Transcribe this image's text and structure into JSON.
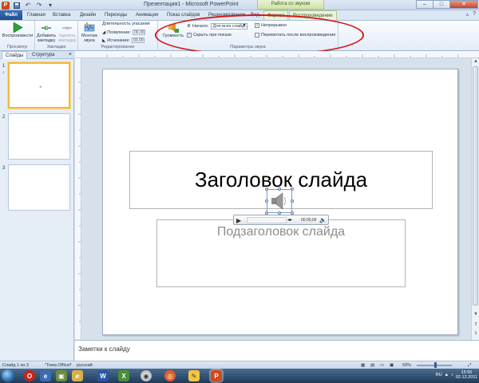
{
  "window": {
    "title": "Презентация1 - Microsoft PowerPoint",
    "context_tab_title": "Работа со звуком",
    "controls": [
      "–",
      "□",
      "✕"
    ]
  },
  "tabs": [
    {
      "label": "Файл",
      "kind": "file"
    },
    {
      "label": "Главная"
    },
    {
      "label": "Вставка"
    },
    {
      "label": "Дизайн"
    },
    {
      "label": "Переходы"
    },
    {
      "label": "Анимация"
    },
    {
      "label": "Показ слайдов"
    },
    {
      "label": "Рецензирование"
    },
    {
      "label": "Вид"
    },
    {
      "label": "Формат",
      "kind": "ctx"
    },
    {
      "label": "Воспроизведение",
      "kind": "ctx-active"
    }
  ],
  "ribbon": {
    "preview": {
      "button": "Воспроизвести",
      "group": "Просмотр"
    },
    "bookmarks": {
      "add": "Добавить закладку",
      "remove": "Удалить закладку",
      "group": "Закладки"
    },
    "editing": {
      "trim": "Монтаж звука",
      "fade_title": "Длительность угасания",
      "fade_in_label": "Появление:",
      "fade_in_value": "00,00",
      "fade_out_label": "Исчезание:",
      "fade_out_value": "00,00",
      "group": "Редактирование"
    },
    "sound_options": {
      "volume": "Громкость",
      "start_label": "Начало:",
      "start_value": "Для всех слайд...",
      "hide_label": "Скрыть при показе",
      "loop_label": "Непрерывно",
      "rewind_label": "Перемотать после воспроизведения",
      "group": "Параметры звука"
    }
  },
  "slide_pane": {
    "tabs": [
      "Слайды",
      "Структура"
    ],
    "close": "×",
    "thumbnails": [
      "1",
      "2",
      "3"
    ]
  },
  "slide": {
    "title": "Заголовок слайда",
    "subtitle": "Подзаголовок слайда",
    "player_time": "00:00,00"
  },
  "notes_placeholder": "Заметки к слайду",
  "status": {
    "slide_of": "Слайд 1 из 3",
    "theme": "\"Тема Office\"",
    "language": "русский",
    "zoom": "59%"
  },
  "taskbar": {
    "lang": "RU",
    "time": "15:56",
    "date": "02.12.2011"
  },
  "colors": {
    "annotation": "#d41a1a",
    "file_tab": "#2b5ea3",
    "ppt_accent": "#c84b1f"
  }
}
